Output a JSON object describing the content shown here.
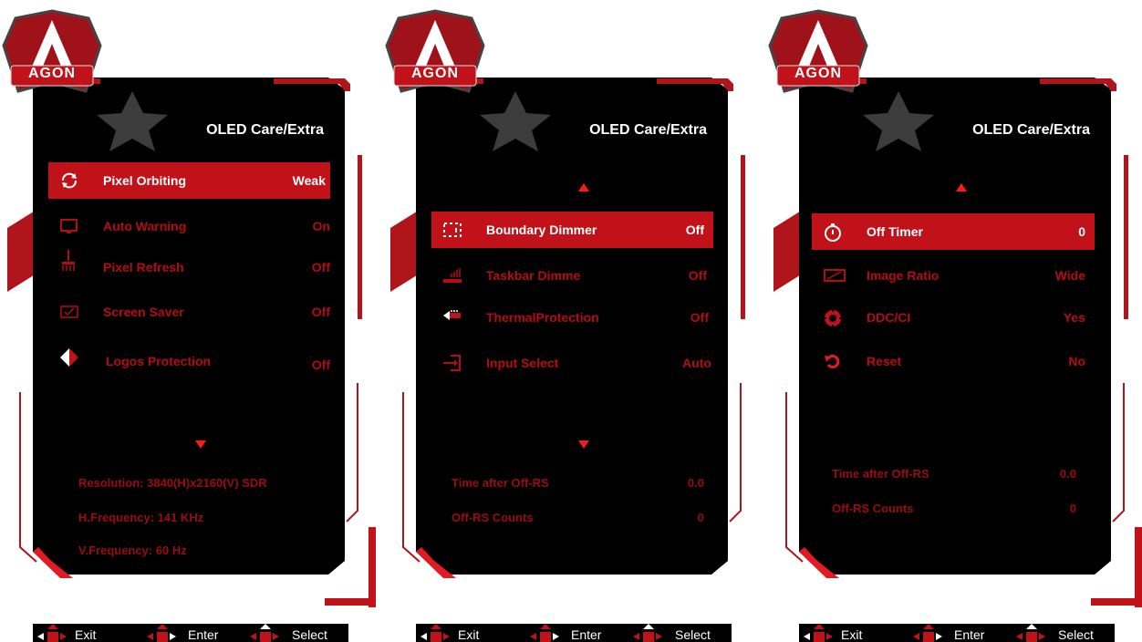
{
  "colors": {
    "accent": "#c1121a",
    "panel_bg": "#000000",
    "dim_text": "#b30d12"
  },
  "brand": "AGON",
  "footer": {
    "exit": "Exit",
    "enter": "Enter",
    "select": "Select"
  },
  "panels": [
    {
      "title": "OLED Care/Extra",
      "items": [
        {
          "icon": "orbit-icon",
          "label": "Pixel Orbiting",
          "value": "Weak",
          "selected": true
        },
        {
          "icon": "monitor-warning-icon",
          "label": "Auto Warning",
          "value": "On"
        },
        {
          "icon": "pixel-refresh-icon",
          "label": "Pixel Refresh",
          "value": "Off"
        },
        {
          "icon": "screen-saver-icon",
          "label": "Screen Saver",
          "value": "Off"
        },
        {
          "icon": "logo-protection-icon",
          "label": "Logos Protection",
          "value": "Off"
        }
      ],
      "info": {
        "resolution": "Resolution: 3840(H)x2160(V) SDR",
        "h_frequency": "H.Frequency: 141 KHz",
        "v_frequency": "V.Frequency: 60 Hz"
      }
    },
    {
      "title": "OLED Care/Extra",
      "items": [
        {
          "icon": "boundary-dimmer-icon",
          "label": "Boundary Dimmer",
          "value": "Off",
          "selected": true
        },
        {
          "icon": "taskbar-dimmer-icon",
          "label": "Taskbar Dimme",
          "value": "Off"
        },
        {
          "icon": "thermal-protection-icon",
          "label": "ThermalProtection",
          "value": "Off"
        },
        {
          "icon": "input-select-icon",
          "label": "Input Select",
          "value": "Auto"
        }
      ],
      "stats": [
        {
          "label": "Time after Off-RS",
          "value": "0.0"
        },
        {
          "label": "Off-RS Counts",
          "value": "0"
        }
      ]
    },
    {
      "title": "OLED Care/Extra",
      "items": [
        {
          "icon": "off-timer-icon",
          "label": "Off Timer",
          "value": "0",
          "selected": true
        },
        {
          "icon": "image-ratio-icon",
          "label": "Image Ratio",
          "value": "Wide"
        },
        {
          "icon": "ddc-ci-icon",
          "label": "DDC/CI",
          "value": "Yes"
        },
        {
          "icon": "reset-icon",
          "label": "Reset",
          "value": "No"
        }
      ],
      "stats": [
        {
          "label": "Time after Off-RS",
          "value": "0.0"
        },
        {
          "label": "Off-RS Counts",
          "value": "0"
        }
      ]
    }
  ]
}
